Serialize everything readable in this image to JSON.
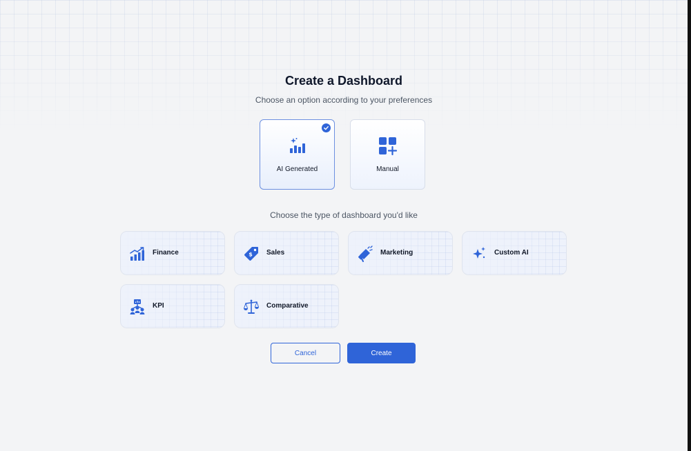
{
  "dialog": {
    "title": "Create a Dashboard",
    "subtitle": "Choose an option according to your preferences"
  },
  "modes": [
    {
      "label": "AI Generated",
      "icon": "ai-chart-icon",
      "selected": true
    },
    {
      "label": "Manual",
      "icon": "grid-plus-icon",
      "selected": false
    }
  ],
  "types_label": "Choose the type of dashboard you'd like",
  "types": [
    {
      "label": "Finance",
      "icon": "finance-chart-icon"
    },
    {
      "label": "Sales",
      "icon": "price-tag-icon"
    },
    {
      "label": "Marketing",
      "icon": "megaphone-icon"
    },
    {
      "label": "Custom AI",
      "icon": "sparkle-icon"
    },
    {
      "label": "KPI",
      "icon": "kpi-network-icon"
    },
    {
      "label": "Comparative",
      "icon": "balance-scale-icon"
    }
  ],
  "actions": {
    "cancel_label": "Cancel",
    "create_label": "Create"
  },
  "colors": {
    "accent": "#2f64d8",
    "background": "#f3f4f6"
  }
}
